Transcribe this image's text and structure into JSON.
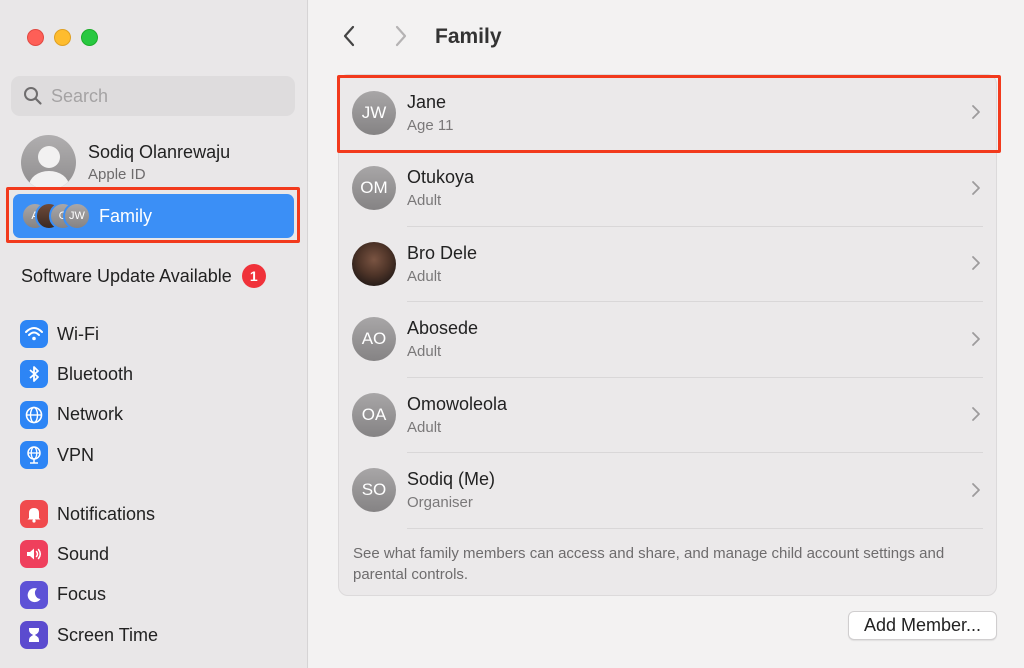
{
  "sidebar": {
    "search_placeholder": "Search",
    "account": {
      "name": "Sodiq Olanrewaju",
      "subtitle": "Apple ID"
    },
    "family": {
      "label": "Family",
      "avatar_initials": [
        "A",
        "",
        "O",
        "JW"
      ]
    },
    "software_update": {
      "label": "Software Update Available",
      "badge": "1"
    },
    "group1": [
      {
        "label": "Wi-Fi",
        "icon": "wifi-icon"
      },
      {
        "label": "Bluetooth",
        "icon": "bluetooth-icon"
      },
      {
        "label": "Network",
        "icon": "globe-icon"
      },
      {
        "label": "VPN",
        "icon": "vpn-globe-icon"
      }
    ],
    "group2": [
      {
        "label": "Notifications",
        "icon": "bell-icon"
      },
      {
        "label": "Sound",
        "icon": "speaker-icon"
      },
      {
        "label": "Focus",
        "icon": "moon-icon"
      },
      {
        "label": "Screen Time",
        "icon": "hourglass-icon"
      }
    ]
  },
  "main": {
    "title": "Family",
    "members": [
      {
        "initials": "JW",
        "name": "Jane",
        "role": "Age 11"
      },
      {
        "initials": "OM",
        "name": "Otukoya",
        "role": "Adult"
      },
      {
        "initials": "",
        "name": "Bro Dele",
        "role": "Adult"
      },
      {
        "initials": "AO",
        "name": "Abosede",
        "role": "Adult"
      },
      {
        "initials": "OA",
        "name": "Omowoleola",
        "role": "Adult"
      },
      {
        "initials": "SO",
        "name": "Sodiq (Me)",
        "role": "Organiser"
      }
    ],
    "footnote": "See what family members can access and share, and manage child account settings and parental controls.",
    "add_member_label": "Add Member..."
  },
  "colors": {
    "accent": "#3b8ff6",
    "highlight_box": "#f23a1d",
    "badge": "#f0323a"
  }
}
